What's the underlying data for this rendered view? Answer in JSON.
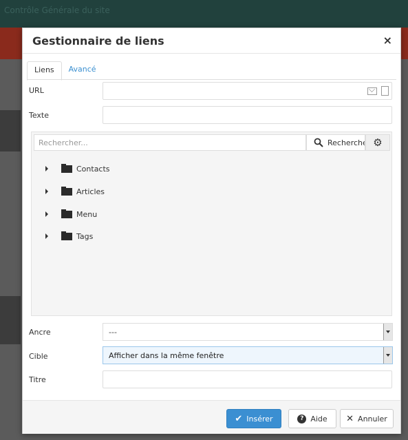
{
  "background": {
    "top_text": "Contrôle Générale du site"
  },
  "modal": {
    "title": "Gestionnaire de liens",
    "close": "×"
  },
  "tabs": [
    {
      "label": "Liens",
      "active": true
    },
    {
      "label": "Avancé",
      "active": false
    }
  ],
  "fields": {
    "url": {
      "label": "URL",
      "value": ""
    },
    "text": {
      "label": "Texte",
      "value": ""
    },
    "anchor": {
      "label": "Ancre",
      "value": "---"
    },
    "target": {
      "label": "Cible",
      "value": "Afficher dans la même fenêtre"
    },
    "title": {
      "label": "Titre",
      "value": ""
    }
  },
  "browser": {
    "search_placeholder": "Rechercher...",
    "search_button": "Recherche",
    "tree": [
      "Contacts",
      "Articles",
      "Menu",
      "Tags"
    ]
  },
  "buttons": {
    "insert": "Insérer",
    "help": "Aide",
    "cancel": "Annuler"
  },
  "colors": {
    "primary": "#3b8fd2",
    "tab_link": "#3a8fd0"
  }
}
